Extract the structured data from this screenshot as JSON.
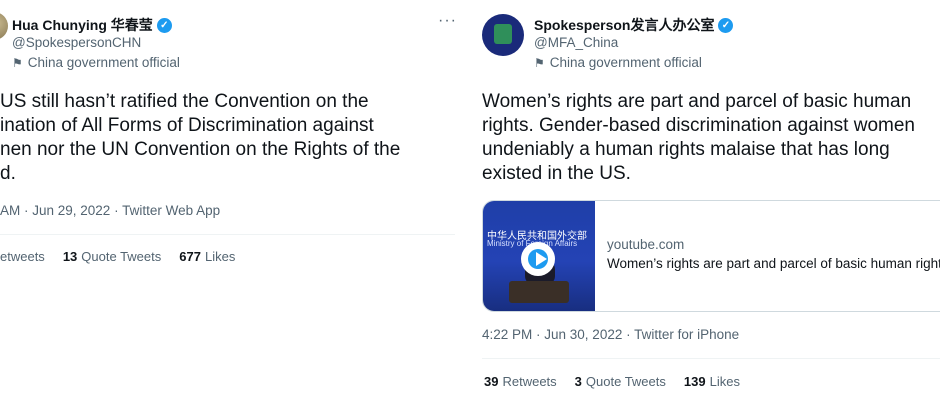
{
  "left_tweet": {
    "display_name": "Hua Chunying 华春莹",
    "handle": "@SpokespersonCHN",
    "label": "China government official",
    "text_lines": [
      "US still hasn’t ratified the Convention on the",
      "ination of All Forms of Discrimination against",
      "nen nor the UN Convention on the Rights of the",
      "d."
    ],
    "meta": "AM · Jun 29, 2022 · Twitter Web App",
    "stats": {
      "retweets_label": "etweets",
      "quote_count": "13",
      "quote_label": "Quote Tweets",
      "likes_count": "677",
      "likes_label": "Likes"
    }
  },
  "right_tweet": {
    "display_name": "Spokesperson发言人办公室",
    "handle": "@MFA_China",
    "label": "China government official",
    "text_lines": [
      "Women’s rights are part and parcel of basic human",
      "rights. Gender-based discrimination against women",
      "undeniably a human rights malaise that has long",
      "existed in the US."
    ],
    "card": {
      "thumb_text_cn": "中华人民共和国外交部",
      "thumb_text_en": "Ministry of Foreign Affairs",
      "domain": "youtube.com",
      "title": "Women’s rights are part and parcel of basic human rights"
    },
    "meta": "4:22 PM · Jun 30, 2022 · Twitter for iPhone",
    "stats": {
      "retweets_count": "39",
      "retweets_label": "Retweets",
      "quote_count": "3",
      "quote_label": "Quote Tweets",
      "likes_count": "139",
      "likes_label": "Likes"
    }
  },
  "icons": {
    "verified": "verified-badge-icon",
    "flag": "flag-icon",
    "more": "more-options-icon",
    "play": "play-icon"
  },
  "colors": {
    "accent": "#1d9bf0",
    "secondary_text": "#536471",
    "primary_text": "#0f1419"
  }
}
